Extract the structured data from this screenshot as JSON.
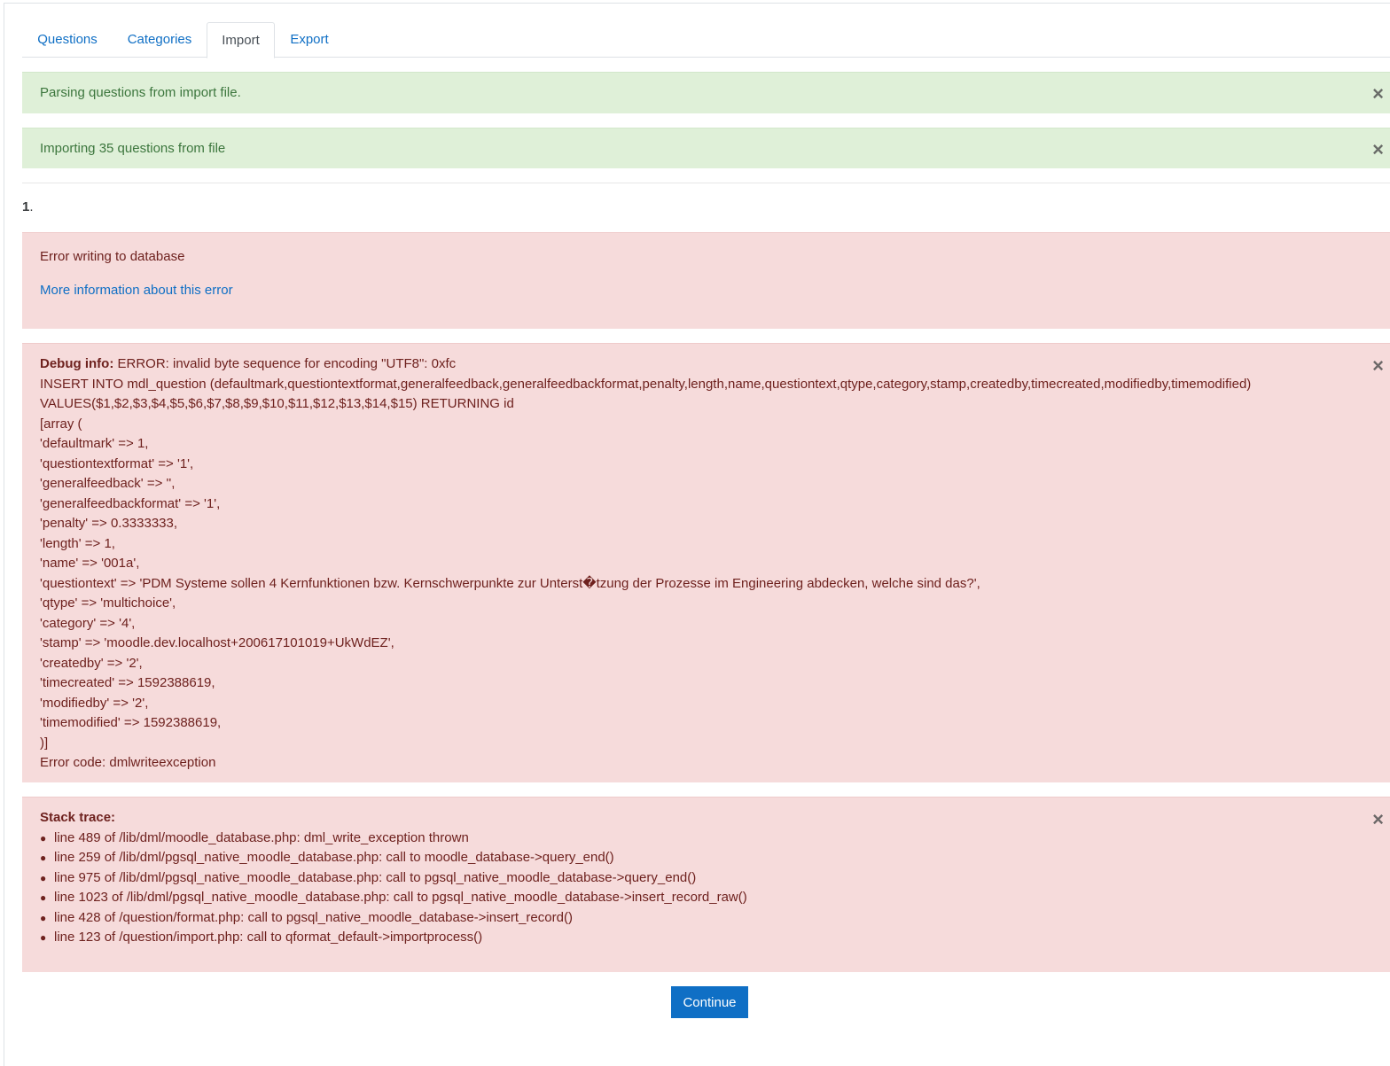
{
  "tabs": [
    {
      "label": "Questions",
      "active": false
    },
    {
      "label": "Categories",
      "active": false
    },
    {
      "label": "Import",
      "active": true
    },
    {
      "label": "Export",
      "active": false
    }
  ],
  "notifications": {
    "parsing": "Parsing questions from import file.",
    "importing": "Importing 35 questions from file",
    "close_glyph": "×"
  },
  "question": {
    "number": "1",
    "suffix": "."
  },
  "error": {
    "title": "Error writing to database",
    "more_info_link": "More information about this error"
  },
  "debug": {
    "label": "Debug info:",
    "first_line": " ERROR: invalid byte sequence for encoding \"UTF8\": 0xfc",
    "lines": [
      "INSERT INTO mdl_question (defaultmark,questiontextformat,generalfeedback,generalfeedbackformat,penalty,length,name,questiontext,qtype,category,stamp,createdby,timecreated,modifiedby,timemodified)",
      "VALUES($1,$2,$3,$4,$5,$6,$7,$8,$9,$10,$11,$12,$13,$14,$15) RETURNING id",
      "[array (",
      "'defaultmark' => 1,",
      "'questiontextformat' => '1',",
      "'generalfeedback' => '',",
      "'generalfeedbackformat' => '1',",
      "'penalty' => 0.3333333,",
      "'length' => 1,",
      "'name' => '001a',",
      "'questiontext' => 'PDM Systeme sollen 4 Kernfunktionen bzw. Kernschwerpunkte zur Unterst�tzung der Prozesse im Engineering abdecken, welche sind das?',",
      "'qtype' => 'multichoice',",
      "'category' => '4',",
      "'stamp' => 'moodle.dev.localhost+200617101019+UkWdEZ',",
      "'createdby' => '2',",
      "'timecreated' => 1592388619,",
      "'modifiedby' => '2',",
      "'timemodified' => 1592388619,",
      ")]",
      "Error code: dmlwriteexception"
    ]
  },
  "stack": {
    "label": "Stack trace:",
    "bullet": "●",
    "items": [
      "line 489 of /lib/dml/moodle_database.php: dml_write_exception thrown",
      "line 259 of /lib/dml/pgsql_native_moodle_database.php: call to moodle_database->query_end()",
      "line 975 of /lib/dml/pgsql_native_moodle_database.php: call to pgsql_native_moodle_database->query_end()",
      "line 1023 of /lib/dml/pgsql_native_moodle_database.php: call to pgsql_native_moodle_database->insert_record_raw()",
      "line 428 of /question/format.php: call to pgsql_native_moodle_database->insert_record()",
      "line 123 of /question/import.php: call to qformat_default->importprocess()"
    ]
  },
  "continue_button": "Continue"
}
